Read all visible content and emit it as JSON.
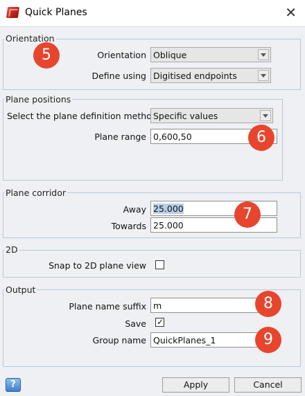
{
  "window": {
    "title": "Quick Planes",
    "icon": "app-icon",
    "close": "close-icon"
  },
  "orientation": {
    "group_title": "Orientation",
    "orientation_label": "Orientation",
    "orientation_value": "Oblique",
    "define_label": "Define using",
    "define_value": "Digitised endpoints"
  },
  "plane_positions": {
    "group_title": "Plane positions",
    "method_label": "Select the plane definition method",
    "method_value": "Specific values",
    "range_label": "Plane range",
    "range_value": "0,600,50"
  },
  "plane_corridor": {
    "group_title": "Plane corridor",
    "away_label": "Away",
    "away_value": "25.000",
    "towards_label": "Towards",
    "towards_value": "25.000"
  },
  "twod": {
    "group_title": "2D",
    "snap_label": "Snap to 2D plane view",
    "snap_checked": false
  },
  "output": {
    "group_title": "Output",
    "suffix_label": "Plane name suffix",
    "suffix_value": "m",
    "save_label": "Save",
    "save_checked": true,
    "save_mark": "✓",
    "group_name_label": "Group name",
    "group_name_value": "QuickPlanes_1"
  },
  "callouts": [
    "5",
    "6",
    "7",
    "8",
    "9"
  ],
  "buttons": {
    "help": "?",
    "apply": "Apply",
    "cancel": "Cancel"
  },
  "colors": {
    "callout": "#e8452e",
    "group_border": "#b9c8da",
    "background": "#eef0f3"
  }
}
